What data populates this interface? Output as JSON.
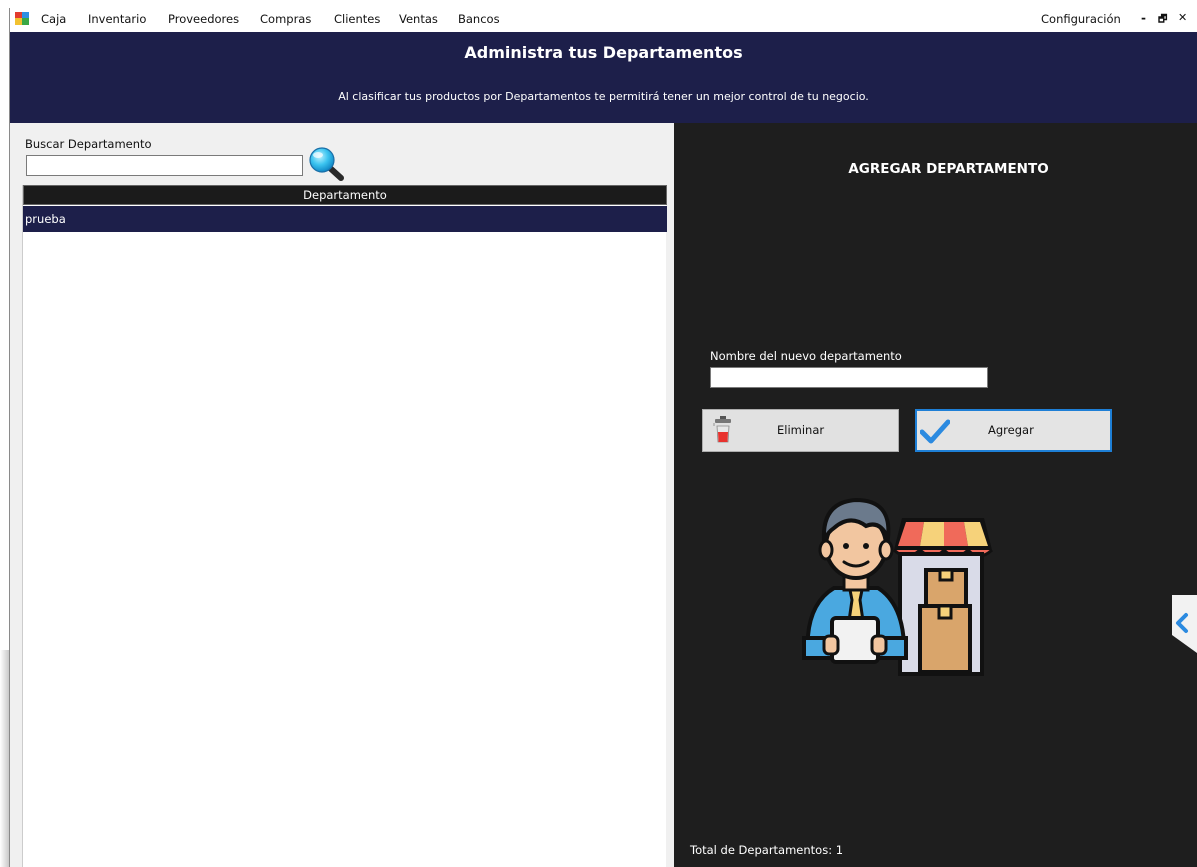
{
  "menubar": {
    "items": [
      "Caja",
      "Inventario",
      "Proveedores",
      "Compras",
      "Clientes",
      "Ventas",
      "Bancos"
    ],
    "config_label": "Configuración",
    "minimize_glyph": "-",
    "restore_glyph": "🗗",
    "close_glyph": "✕"
  },
  "header": {
    "title": "Administra tus Departamentos",
    "subtitle": "Al clasificar tus productos por Departamentos te permitirá tener un mejor control de tu negocio."
  },
  "search": {
    "label": "Buscar Departamento",
    "value": ""
  },
  "grid": {
    "columns": [
      "Departamento"
    ],
    "rows": [
      [
        "prueba"
      ]
    ]
  },
  "form": {
    "section_title": "AGREGAR DEPARTAMENTO",
    "name_label": "Nombre del nuevo departamento",
    "name_value": "",
    "delete_label": "Eliminar",
    "add_label": "Agregar"
  },
  "footer": {
    "total_label": "Total de Departamentos:",
    "total_value": "1"
  },
  "icons": {
    "app": "app-icon",
    "search": "magnifier-icon",
    "delete": "trash-can-icon",
    "add": "checkmark-icon",
    "illustration": "shopkeeper-illustration",
    "collapse": "chevron-left-icon"
  },
  "colors": {
    "header_bg": "#1d1f4a",
    "right_pane_bg": "#1e1e1e",
    "left_pane_bg": "#f0f0f0",
    "selected_row_bg": "#1d1f4a",
    "add_button_border": "#1e7fd6"
  }
}
